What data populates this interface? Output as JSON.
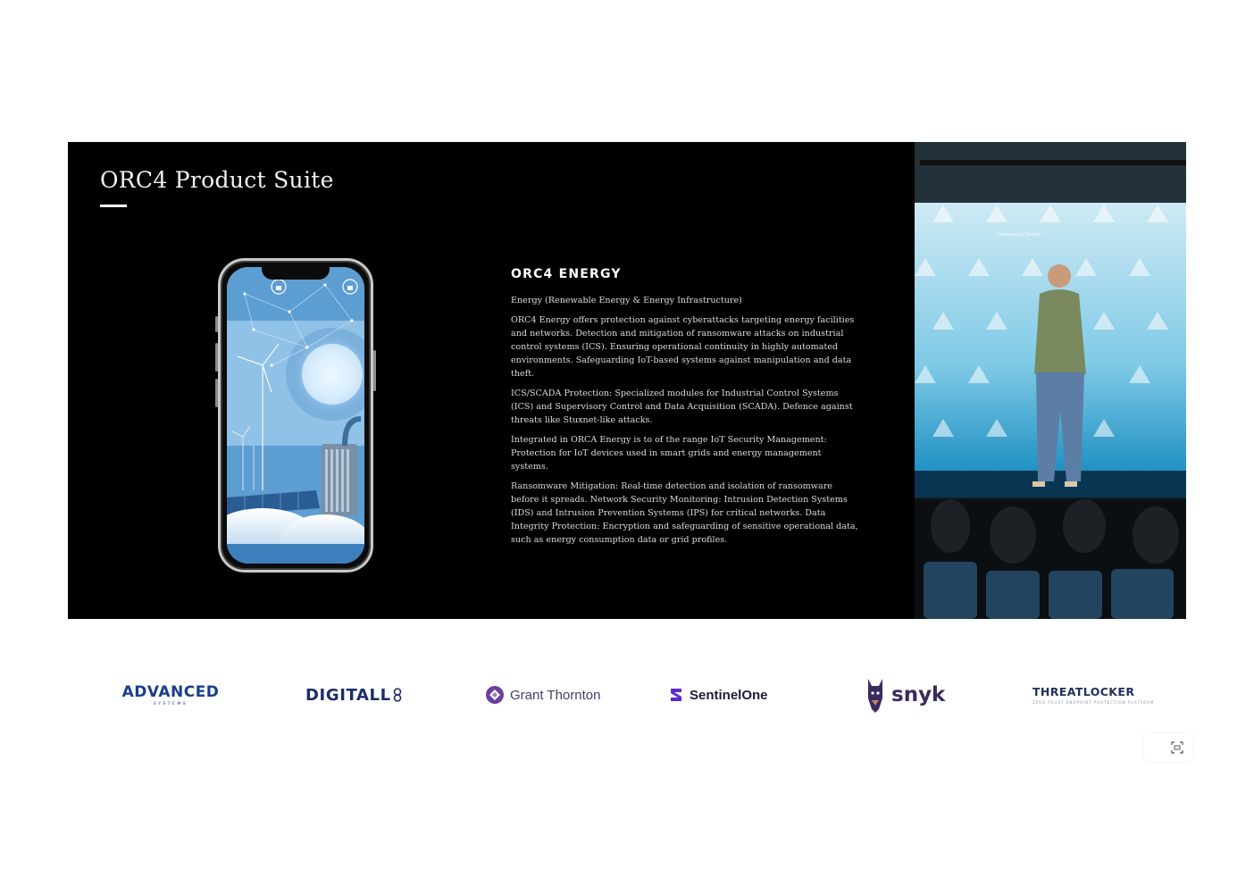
{
  "slide": {
    "title": "ORC4 Product Suite",
    "section_heading": "ORC4 ENERGY",
    "subtitle": "Energy (Renewable Energy & Energy Infrastructure)",
    "paragraphs": [
      "ORC4 Energy offers protection against cyberattacks targeting energy facilities and networks. Detection and mitigation of ransomware attacks on industrial control systems (ICS). Ensuring operational continuity in highly automated environments. Safeguarding IoT-based systems against manipulation and data theft.",
      "ICS/SCADA Protection: Specialized modules for Industrial Control Systems (ICS) and Supervisory Control and Data Acquisition (SCADA). Defence against threats like Stuxnet-like attacks.",
      "Integrated in ORCA Energy is to of the range IoT Security Management: Protection for IoT devices used in smart grids and energy management systems.",
      "Ransomware Mitigation: Real-time detection and isolation of ransomware before it spreads. Network Security Monitoring: Intrusion Detection Systems (IDS) and Intrusion Prevention Systems (IPS) for critical networks. Data Integrity Protection: Encryption and safeguarding of sensitive operational data, such as energy consumption data or grid profiles."
    ]
  },
  "camera": {
    "backdrop_label": "Cybersecurity Summit"
  },
  "sponsors": {
    "advanced": "ADVANCED",
    "advanced_sub": "SYSTEMS",
    "digitall": "DIGITALL",
    "grant_thornton": "Grant Thornton",
    "sentinelone": "SentinelOne",
    "snyk": "snyk",
    "threatlocker": "THREATLOCKER",
    "threatlocker_sub": "ZERO TRUST ENDPOINT PROTECTION PLATFORM"
  },
  "colors": {
    "slide_bg": "#000000",
    "text": "#dcdcdc",
    "backdrop": "#4fb3d9"
  },
  "icons": {
    "capture": "capture-icon"
  }
}
